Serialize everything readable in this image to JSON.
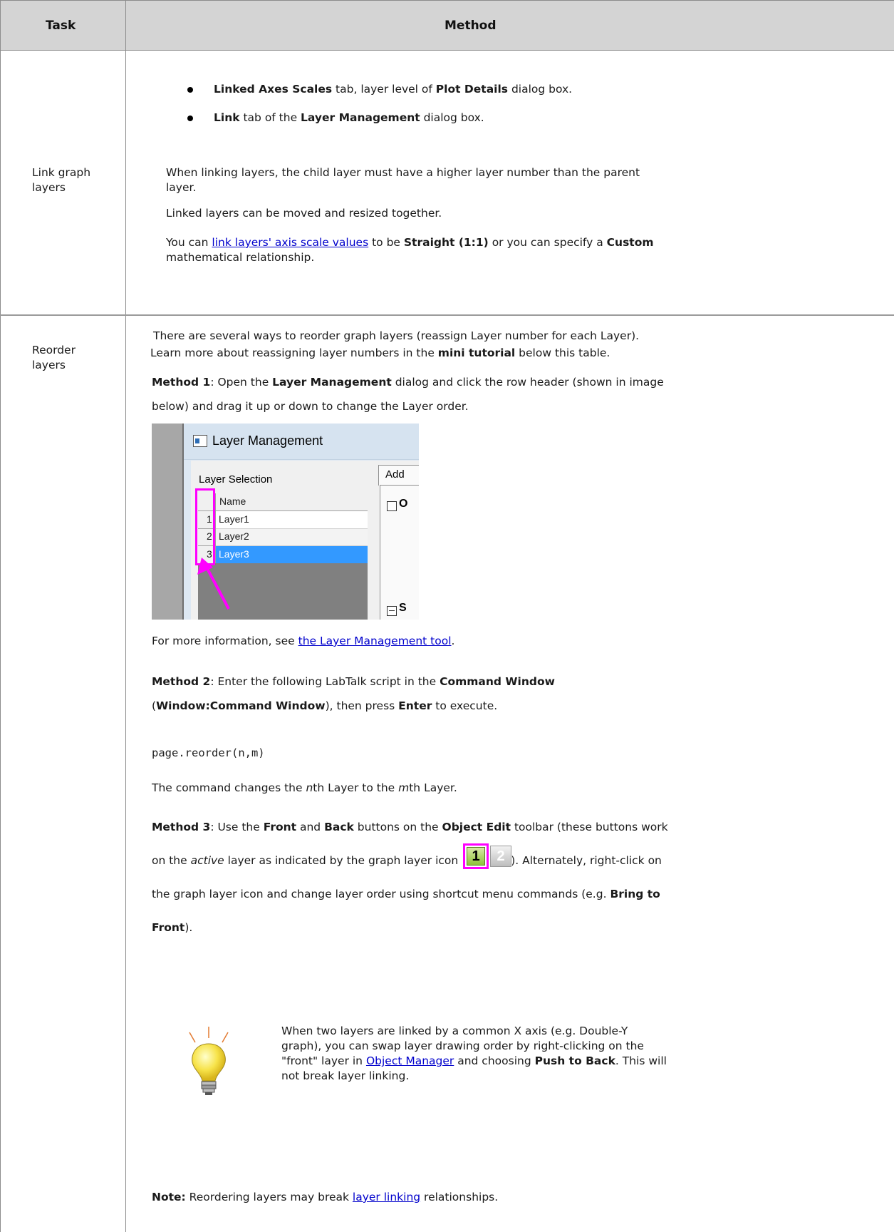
{
  "table": {
    "header": {
      "task": "Task",
      "method": "Method"
    },
    "row1": {
      "task_line1": "Link graph",
      "task_line2": "layers",
      "bullet1": {
        "b1": "Linked Axes Scales",
        "t1": " tab, layer level of ",
        "b2": "Plot Details",
        "t2": " dialog box."
      },
      "bullet2": {
        "b1": "Link",
        "t1": " tab of the ",
        "b2": "Layer Management",
        "t2": " dialog box."
      },
      "para1_line1": "When linking layers, the child layer must have a higher layer number than the parent",
      "para1_line2": "layer.",
      "para2": "Linked layers can be moved and resized together.",
      "para3": {
        "t1": "You can ",
        "link": "link layers' axis scale values",
        "t2": " to be ",
        "b1": "Straight (1:1)",
        "t3": " or you can specify a ",
        "b2": "Custom"
      },
      "para3_line2": "mathematical relationship."
    },
    "row2": {
      "task_line1": "Reorder",
      "task_line2": "layers",
      "intro_line1": "There are several ways to reorder graph layers (reassign Layer number for each Layer).",
      "intro_line2": {
        "t1": "Learn more about reassigning layer numbers in the ",
        "b1": "mini tutorial",
        "t2": " below this table."
      },
      "method1_line1": {
        "b1": "Method 1",
        "t1": ": Open the ",
        "b2": "Layer Management",
        "t2": " dialog and click the row header (shown in image"
      },
      "method1_line2": "below) and drag it up or down to change the Layer order.",
      "dialog": {
        "title": "Layer Management",
        "selection_label": "Layer Selection",
        "tab_label": "Add",
        "column_header": "Name",
        "rows": [
          {
            "num": "1",
            "name": "Layer1"
          },
          {
            "num": "2",
            "name": "Layer2"
          },
          {
            "num": "3",
            "name": "Layer3"
          }
        ],
        "checkbox_label_1": "O",
        "checkbox_label_2": "S"
      },
      "more_info": {
        "t1": "For more information, see ",
        "link": "the Layer Management tool",
        "t2": "."
      },
      "method2_line1": {
        "b1": "Method 2",
        "t1": ": Enter the following LabTalk script in the ",
        "b2": "Command Window"
      },
      "method2_line2": {
        "t1": "(",
        "b1": "Window:Command Window",
        "t2": "), then press ",
        "b2": "Enter",
        "t3": " to execute."
      },
      "code": "page.reorder(n,m)",
      "command_desc": {
        "t1": "The command changes the ",
        "i1": "n",
        "t2": "th Layer to the ",
        "i2": "m",
        "t3": "th Layer."
      },
      "method3_line1": {
        "b1": "Method 3",
        "t1": ": Use the ",
        "b2": "Front",
        "t2": " and ",
        "b3": "Back",
        "t3": " buttons on the ",
        "b4": "Object Edit",
        "t4": " toolbar (these buttons work"
      },
      "method3_line2": {
        "t1": "on the ",
        "i1": "active",
        "t2": " layer as indicated by the graph layer icon",
        "t3": "). Alternately, right-click on"
      },
      "layer_icon": {
        "num1": "1",
        "num2": "2"
      },
      "method3_line3": {
        "t1": "the graph layer icon and change layer order using shortcut menu commands (e.g. ",
        "b1": "Bring to"
      },
      "method3_line4": {
        "b1": "Front",
        "t1": ")."
      },
      "tip_line1": "When two layers are linked by a common X axis (e.g. Double-Y",
      "tip_line2": "graph), you can swap layer drawing order by right-clicking on the",
      "tip_line3": {
        "t1": "\"front\" layer in ",
        "link": "Object Manager",
        "t2": " and choosing ",
        "b1": "Push to Back",
        "t3": ". This will"
      },
      "tip_line4": "not break layer linking.",
      "note": {
        "b1": "Note:",
        "t1": " Reordering layers may break ",
        "link": "layer linking",
        "t2": " relationships."
      }
    }
  },
  "colors": {
    "header_bg": "#d4d4d4",
    "link": "#0000cc",
    "highlight_magenta": "#ff00ff",
    "selection_blue": "#3399ff"
  }
}
